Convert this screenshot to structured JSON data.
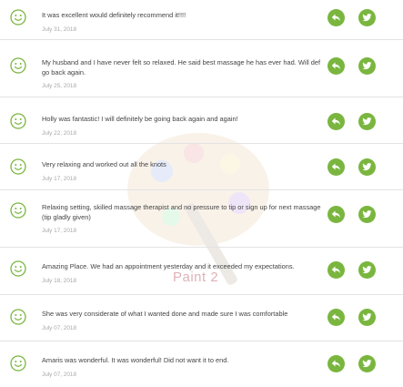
{
  "reviews": [
    {
      "text": "It was excellent would definitely recommend it!!!!",
      "date": "July 31, 2018"
    },
    {
      "text": "My husband and I have never felt so relaxed. He said best massage he has ever had. Will def go back again.",
      "date": "July 25, 2018"
    },
    {
      "text": "Holly was fantastic! I will definitely be going back again and again!",
      "date": "July 22, 2018"
    },
    {
      "text": "Very relaxing and worked out all the knots",
      "date": "July 17, 2018"
    },
    {
      "text": "Relaxing setting, skilled massage therapist and no pressure to tip or sign up for next massage (tip gladly given)",
      "date": "July 17, 2018"
    },
    {
      "text": "Amazing Place. We had an appointment yesterday and it exceeded my expectations.",
      "date": "July 18, 2018"
    },
    {
      "text": "She was very considerate of what I wanted done and made sure I was comfortable",
      "date": "July 07, 2018"
    },
    {
      "text": "Amaris was wonderful. It was wonderful! Did not want it to end.",
      "date": "July 07, 2018"
    }
  ],
  "icons": {
    "smiley": "smiley-face-icon",
    "reply": "reply-arrow-icon",
    "twitter": "twitter-bird-icon"
  },
  "colors": {
    "accent": "#7ab63f",
    "date": "#a8a8a8",
    "divider": "#e3e3e3"
  },
  "watermark": {
    "text": "Paint 2"
  }
}
